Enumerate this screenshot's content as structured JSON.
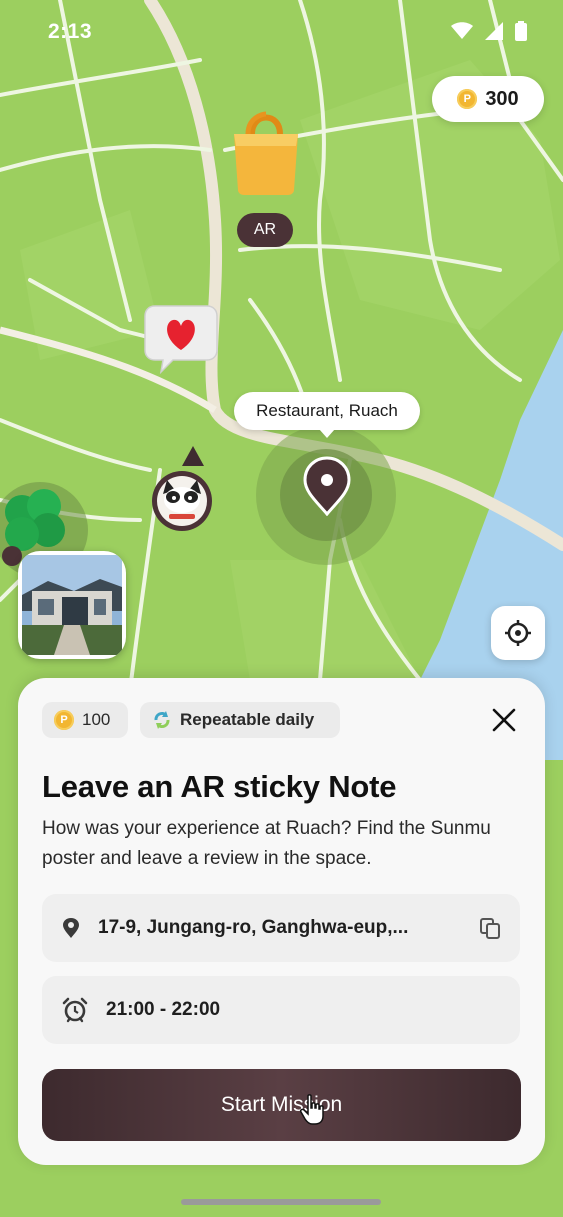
{
  "status_bar": {
    "time": "2:13",
    "icons": [
      "wifi-icon",
      "cellular-icon",
      "battery-icon"
    ]
  },
  "wallet": {
    "coin_symbol": "P",
    "balance": "300"
  },
  "map": {
    "ar_badge": "AR",
    "place_tooltip": "Restaurant, Ruach",
    "markers": [
      "shopping-bag-icon",
      "heart-sticker-icon",
      "cat-avatar-marker",
      "clover-icon",
      "building-photo-marker",
      "location-pin-icon"
    ]
  },
  "mission": {
    "reward": {
      "coin_symbol": "P",
      "value": "100"
    },
    "repeat_label": "Repeatable daily",
    "title": "Leave an AR sticky Note",
    "description": "How was your experience at Ruach? Find the Sunmu poster and leave a review in the space.",
    "address": "17-9, Jungang-ro, Ganghwa-eup,...",
    "time_window": "21:00 - 22:00",
    "start_button": "Start Mission"
  },
  "colors": {
    "map_green": "#9ccf5f",
    "river_blue": "#a9d2ee",
    "button_dark": "#4a3236",
    "coin_gold": "#f2b631"
  }
}
